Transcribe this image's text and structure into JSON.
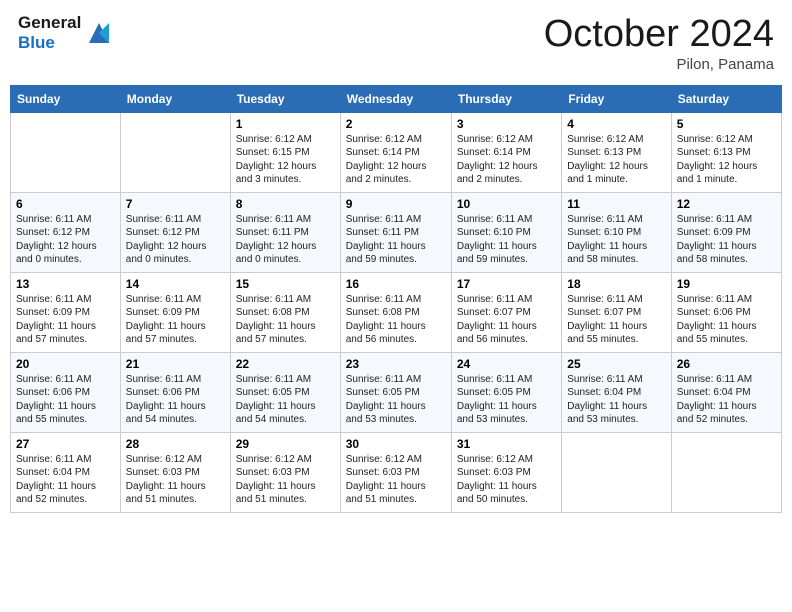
{
  "header": {
    "logo_general": "General",
    "logo_blue": "Blue",
    "month_title": "October 2024",
    "location": "Pilon, Panama"
  },
  "weekdays": [
    "Sunday",
    "Monday",
    "Tuesday",
    "Wednesday",
    "Thursday",
    "Friday",
    "Saturday"
  ],
  "weeks": [
    [
      {
        "day": "",
        "info": ""
      },
      {
        "day": "",
        "info": ""
      },
      {
        "day": "1",
        "info": "Sunrise: 6:12 AM\nSunset: 6:15 PM\nDaylight: 12 hours\nand 3 minutes."
      },
      {
        "day": "2",
        "info": "Sunrise: 6:12 AM\nSunset: 6:14 PM\nDaylight: 12 hours\nand 2 minutes."
      },
      {
        "day": "3",
        "info": "Sunrise: 6:12 AM\nSunset: 6:14 PM\nDaylight: 12 hours\nand 2 minutes."
      },
      {
        "day": "4",
        "info": "Sunrise: 6:12 AM\nSunset: 6:13 PM\nDaylight: 12 hours\nand 1 minute."
      },
      {
        "day": "5",
        "info": "Sunrise: 6:12 AM\nSunset: 6:13 PM\nDaylight: 12 hours\nand 1 minute."
      }
    ],
    [
      {
        "day": "6",
        "info": "Sunrise: 6:11 AM\nSunset: 6:12 PM\nDaylight: 12 hours\nand 0 minutes."
      },
      {
        "day": "7",
        "info": "Sunrise: 6:11 AM\nSunset: 6:12 PM\nDaylight: 12 hours\nand 0 minutes."
      },
      {
        "day": "8",
        "info": "Sunrise: 6:11 AM\nSunset: 6:11 PM\nDaylight: 12 hours\nand 0 minutes."
      },
      {
        "day": "9",
        "info": "Sunrise: 6:11 AM\nSunset: 6:11 PM\nDaylight: 11 hours\nand 59 minutes."
      },
      {
        "day": "10",
        "info": "Sunrise: 6:11 AM\nSunset: 6:10 PM\nDaylight: 11 hours\nand 59 minutes."
      },
      {
        "day": "11",
        "info": "Sunrise: 6:11 AM\nSunset: 6:10 PM\nDaylight: 11 hours\nand 58 minutes."
      },
      {
        "day": "12",
        "info": "Sunrise: 6:11 AM\nSunset: 6:09 PM\nDaylight: 11 hours\nand 58 minutes."
      }
    ],
    [
      {
        "day": "13",
        "info": "Sunrise: 6:11 AM\nSunset: 6:09 PM\nDaylight: 11 hours\nand 57 minutes."
      },
      {
        "day": "14",
        "info": "Sunrise: 6:11 AM\nSunset: 6:09 PM\nDaylight: 11 hours\nand 57 minutes."
      },
      {
        "day": "15",
        "info": "Sunrise: 6:11 AM\nSunset: 6:08 PM\nDaylight: 11 hours\nand 57 minutes."
      },
      {
        "day": "16",
        "info": "Sunrise: 6:11 AM\nSunset: 6:08 PM\nDaylight: 11 hours\nand 56 minutes."
      },
      {
        "day": "17",
        "info": "Sunrise: 6:11 AM\nSunset: 6:07 PM\nDaylight: 11 hours\nand 56 minutes."
      },
      {
        "day": "18",
        "info": "Sunrise: 6:11 AM\nSunset: 6:07 PM\nDaylight: 11 hours\nand 55 minutes."
      },
      {
        "day": "19",
        "info": "Sunrise: 6:11 AM\nSunset: 6:06 PM\nDaylight: 11 hours\nand 55 minutes."
      }
    ],
    [
      {
        "day": "20",
        "info": "Sunrise: 6:11 AM\nSunset: 6:06 PM\nDaylight: 11 hours\nand 55 minutes."
      },
      {
        "day": "21",
        "info": "Sunrise: 6:11 AM\nSunset: 6:06 PM\nDaylight: 11 hours\nand 54 minutes."
      },
      {
        "day": "22",
        "info": "Sunrise: 6:11 AM\nSunset: 6:05 PM\nDaylight: 11 hours\nand 54 minutes."
      },
      {
        "day": "23",
        "info": "Sunrise: 6:11 AM\nSunset: 6:05 PM\nDaylight: 11 hours\nand 53 minutes."
      },
      {
        "day": "24",
        "info": "Sunrise: 6:11 AM\nSunset: 6:05 PM\nDaylight: 11 hours\nand 53 minutes."
      },
      {
        "day": "25",
        "info": "Sunrise: 6:11 AM\nSunset: 6:04 PM\nDaylight: 11 hours\nand 53 minutes."
      },
      {
        "day": "26",
        "info": "Sunrise: 6:11 AM\nSunset: 6:04 PM\nDaylight: 11 hours\nand 52 minutes."
      }
    ],
    [
      {
        "day": "27",
        "info": "Sunrise: 6:11 AM\nSunset: 6:04 PM\nDaylight: 11 hours\nand 52 minutes."
      },
      {
        "day": "28",
        "info": "Sunrise: 6:12 AM\nSunset: 6:03 PM\nDaylight: 11 hours\nand 51 minutes."
      },
      {
        "day": "29",
        "info": "Sunrise: 6:12 AM\nSunset: 6:03 PM\nDaylight: 11 hours\nand 51 minutes."
      },
      {
        "day": "30",
        "info": "Sunrise: 6:12 AM\nSunset: 6:03 PM\nDaylight: 11 hours\nand 51 minutes."
      },
      {
        "day": "31",
        "info": "Sunrise: 6:12 AM\nSunset: 6:03 PM\nDaylight: 11 hours\nand 50 minutes."
      },
      {
        "day": "",
        "info": ""
      },
      {
        "day": "",
        "info": ""
      }
    ]
  ]
}
